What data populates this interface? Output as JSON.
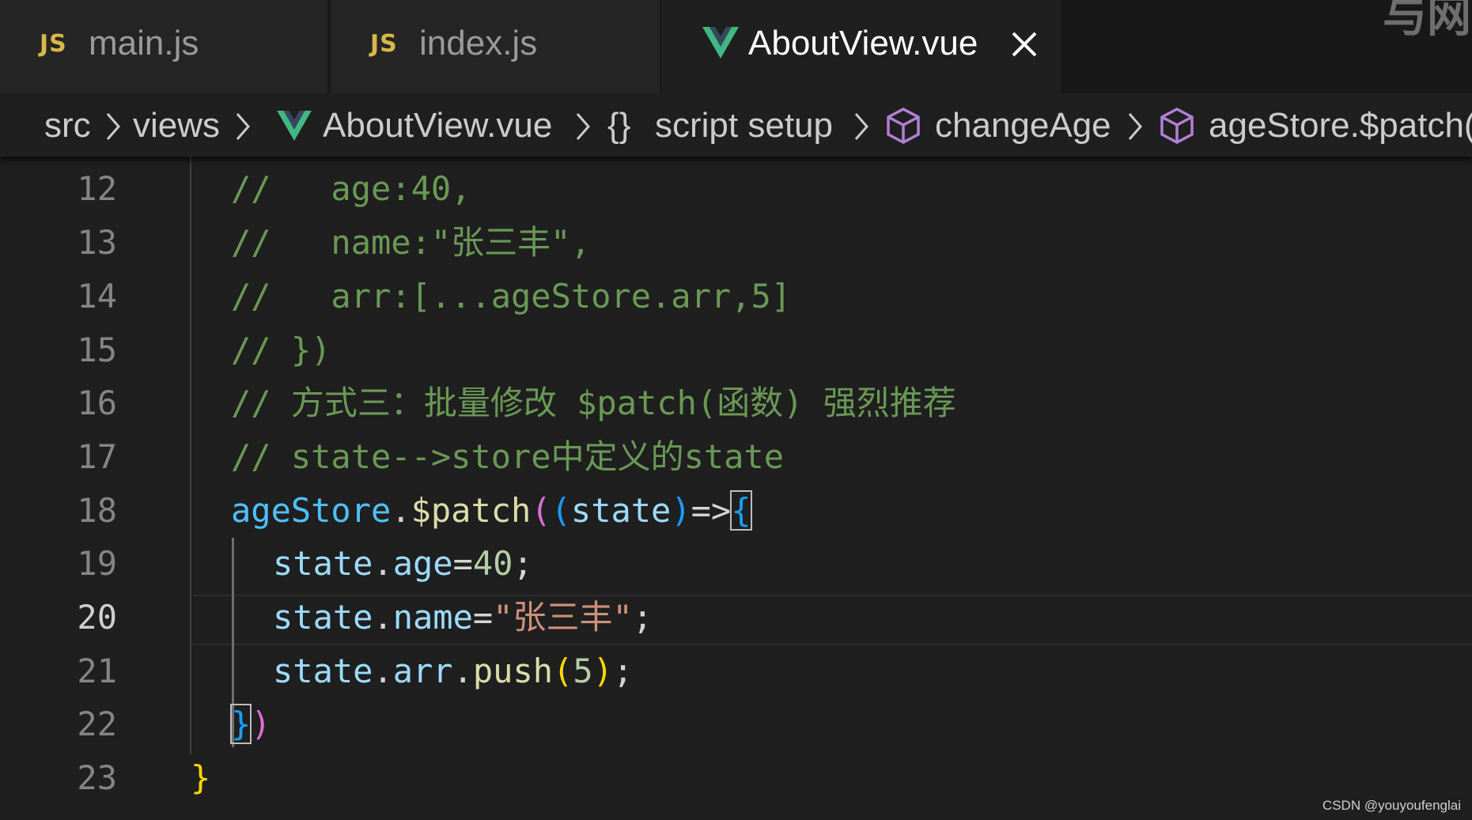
{
  "tabs": [
    {
      "icon": "JS",
      "label": "main.js",
      "active": false
    },
    {
      "icon": "JS",
      "label": "index.js",
      "active": false
    },
    {
      "icon": "vue-icon",
      "label": "AboutView.vue",
      "active": true
    }
  ],
  "top_right_text": "与网",
  "breadcrumb": {
    "src": "src",
    "views": "views",
    "file": "AboutView.vue",
    "braces": "{}",
    "script": "script setup",
    "fn": "changeAge",
    "call": "ageStore.$patch("
  },
  "editor": {
    "active_line": 20,
    "lines": [
      {
        "num": "12",
        "tokens": [
          {
            "t": "//   age:40,",
            "c": "comment"
          }
        ]
      },
      {
        "num": "13",
        "tokens": [
          {
            "t": "//   name:\"张三丰\",",
            "c": "comment"
          }
        ]
      },
      {
        "num": "14",
        "tokens": [
          {
            "t": "//   arr:[...ageStore.arr,5]",
            "c": "comment"
          }
        ]
      },
      {
        "num": "15",
        "tokens": [
          {
            "t": "// })",
            "c": "comment"
          }
        ]
      },
      {
        "num": "16",
        "tokens": [
          {
            "t": "// 方式三：批量修改 $patch(函数) 强烈推荐",
            "c": "comment"
          }
        ]
      },
      {
        "num": "17",
        "tokens": [
          {
            "t": "// state-->store中定义的state",
            "c": "comment"
          }
        ]
      },
      {
        "num": "18",
        "tokens": [
          {
            "t": "ageStore",
            "c": "var"
          },
          {
            "t": ".",
            "c": "punc"
          },
          {
            "t": "$patch",
            "c": "fn"
          },
          {
            "t": "(",
            "c": "b2"
          },
          {
            "t": "(",
            "c": "b3"
          },
          {
            "t": "state",
            "c": "prop"
          },
          {
            "t": ")",
            "c": "b3"
          },
          {
            "t": "=>",
            "c": "punc"
          },
          {
            "t": "{",
            "c": "b3 bracket-box"
          }
        ]
      },
      {
        "num": "19",
        "tokens": [
          {
            "t": "state",
            "c": "prop"
          },
          {
            "t": ".",
            "c": "punc"
          },
          {
            "t": "age",
            "c": "prop"
          },
          {
            "t": "=",
            "c": "punc"
          },
          {
            "t": "40",
            "c": "num"
          },
          {
            "t": ";",
            "c": "punc"
          }
        ]
      },
      {
        "num": "20",
        "tokens": [
          {
            "t": "state",
            "c": "prop"
          },
          {
            "t": ".",
            "c": "punc"
          },
          {
            "t": "name",
            "c": "prop"
          },
          {
            "t": "=",
            "c": "punc"
          },
          {
            "t": "\"张三丰\"",
            "c": "str"
          },
          {
            "t": ";",
            "c": "punc"
          }
        ]
      },
      {
        "num": "21",
        "tokens": [
          {
            "t": "state",
            "c": "prop"
          },
          {
            "t": ".",
            "c": "punc"
          },
          {
            "t": "arr",
            "c": "prop"
          },
          {
            "t": ".",
            "c": "punc"
          },
          {
            "t": "push",
            "c": "fn"
          },
          {
            "t": "(",
            "c": "b1"
          },
          {
            "t": "5",
            "c": "num"
          },
          {
            "t": ")",
            "c": "b1"
          },
          {
            "t": ";",
            "c": "punc"
          }
        ]
      },
      {
        "num": "22",
        "tokens": [
          {
            "t": "}",
            "c": "b3 bracket-box"
          },
          {
            "t": ")",
            "c": "b2"
          }
        ]
      },
      {
        "num": "23",
        "tokens": [
          {
            "t": "}",
            "c": "b1"
          }
        ]
      }
    ]
  },
  "watermark": "CSDN @youyoufenglai",
  "colors": {
    "background": "#1f1f1f",
    "comment": "#6a9955",
    "vue_green": "#41b883",
    "js_yellow": "#d7b946",
    "cube_purple": "#b180d7"
  }
}
